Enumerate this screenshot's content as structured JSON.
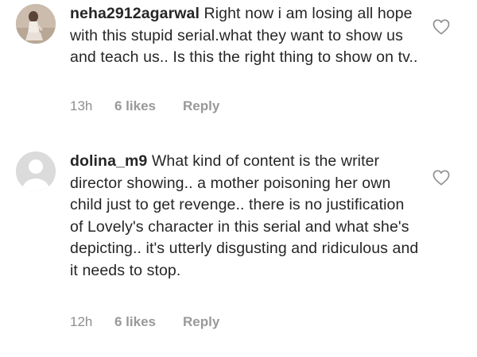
{
  "comments": [
    {
      "username": "neha2912agarwal",
      "text": "Right now i am losing all hope with this stupid serial.what they want to show us and teach us.. Is this the right thing to show on tv..",
      "time": "13h",
      "likes": "6 likes",
      "reply_label": "Reply",
      "avatar": "profile-photo",
      "like_icon": "heart-outline-icon"
    },
    {
      "username": "dolina_m9",
      "text": "What kind of content is the writer director showing.. a mother poisoning her own child just to get revenge.. there is no justification of Lovely's character in this serial and what she's depicting.. it's utterly disgusting and ridiculous and it needs to stop.",
      "time": "12h",
      "likes": "6 likes",
      "reply_label": "Reply",
      "avatar": "default-avatar",
      "like_icon": "heart-outline-icon"
    }
  ],
  "colors": {
    "text": "#262626",
    "meta": "#8e8e8e",
    "heart": "#8e8e8e"
  }
}
